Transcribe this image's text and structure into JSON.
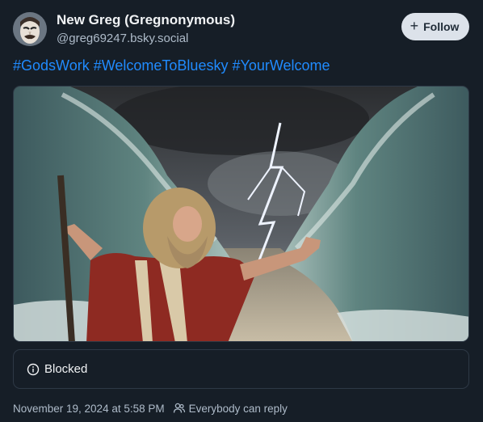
{
  "author": {
    "display_name": "New Greg (Gregnonymous)",
    "handle": "@greg69247.bsky.social"
  },
  "follow_button": {
    "label": "Follow",
    "icon": "plus-icon"
  },
  "post": {
    "hashtags": [
      "#GodsWork",
      "#WelcomeToBluesky",
      "#YourWelcome"
    ]
  },
  "embed": {
    "blocked_label": "Blocked",
    "blocked_icon": "info-icon"
  },
  "meta": {
    "timestamp": "November 19, 2024 at 5:58 PM",
    "reply_setting": "Everybody can reply",
    "reply_icon": "people-icon"
  },
  "colors": {
    "background": "#161e27",
    "link": "#208bfe",
    "muted": "#aebbc9",
    "border": "#2e3946"
  }
}
